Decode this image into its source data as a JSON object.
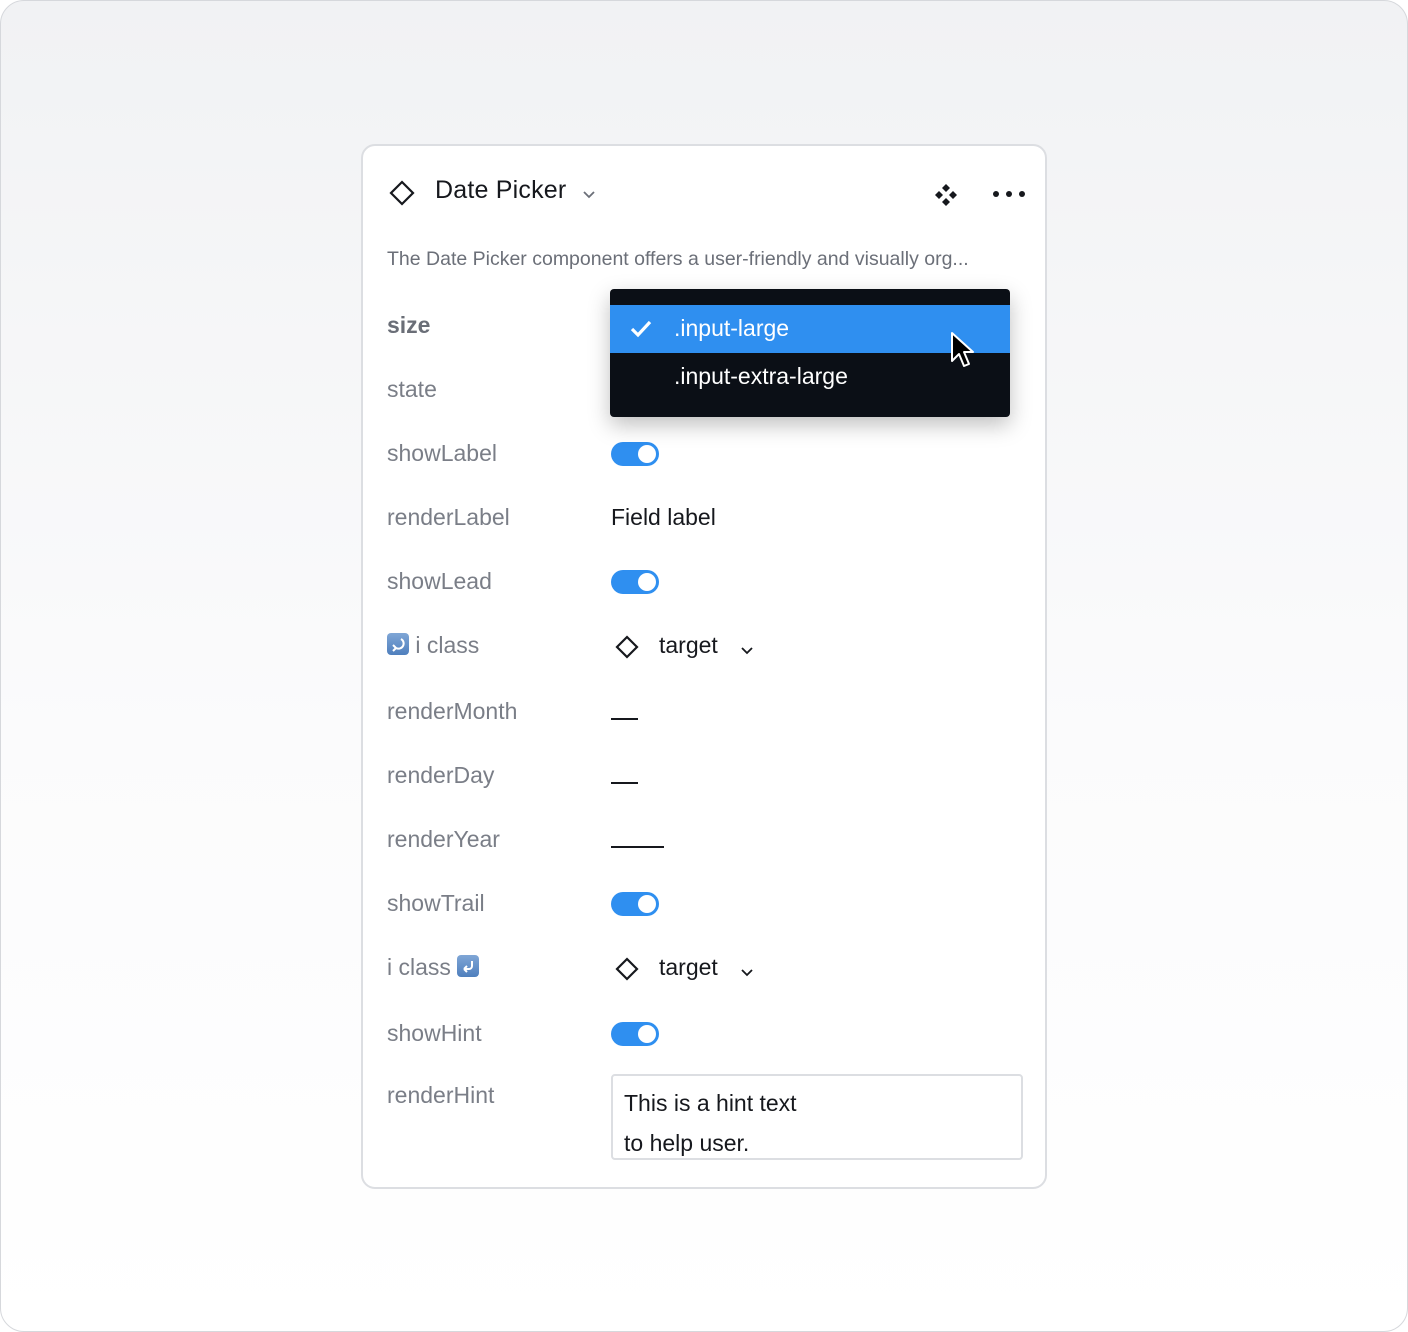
{
  "panel": {
    "title": "Date Picker",
    "description": "The Date Picker component offers a user-friendly and visually org...",
    "icons": {
      "component": "component-diamond-icon",
      "title_dropdown": "chevron-down-icon",
      "go_to_main": "main-component-icon",
      "more": "more-horizontal-icon"
    }
  },
  "properties": {
    "size": {
      "label": "size"
    },
    "state": {
      "label": "state"
    },
    "showLabel": {
      "label": "showLabel",
      "value": true
    },
    "renderLabel": {
      "label": "renderLabel",
      "value": "Field label"
    },
    "showLead": {
      "label": "showLead",
      "value": true
    },
    "leadIcon": {
      "label": "i class",
      "value": "target"
    },
    "renderMonth": {
      "label": "renderMonth"
    },
    "renderDay": {
      "label": "renderDay"
    },
    "renderYear": {
      "label": "renderYear"
    },
    "showTrail": {
      "label": "showTrail",
      "value": true
    },
    "trailIcon": {
      "label": "i class",
      "value": "target"
    },
    "showHint": {
      "label": "showHint",
      "value": true
    },
    "renderHint": {
      "label": "renderHint",
      "line1": "This is a hint text",
      "line2": "to help user."
    }
  },
  "dropdown": {
    "options": [
      {
        "label": ".input-large",
        "selected": true
      },
      {
        "label": ".input-extra-large",
        "selected": false
      }
    ]
  },
  "colors": {
    "accent": "#2f8ff0",
    "dropdown_bg": "#0b0f16",
    "label_text": "#7a7e87",
    "value_text": "#16181d"
  }
}
